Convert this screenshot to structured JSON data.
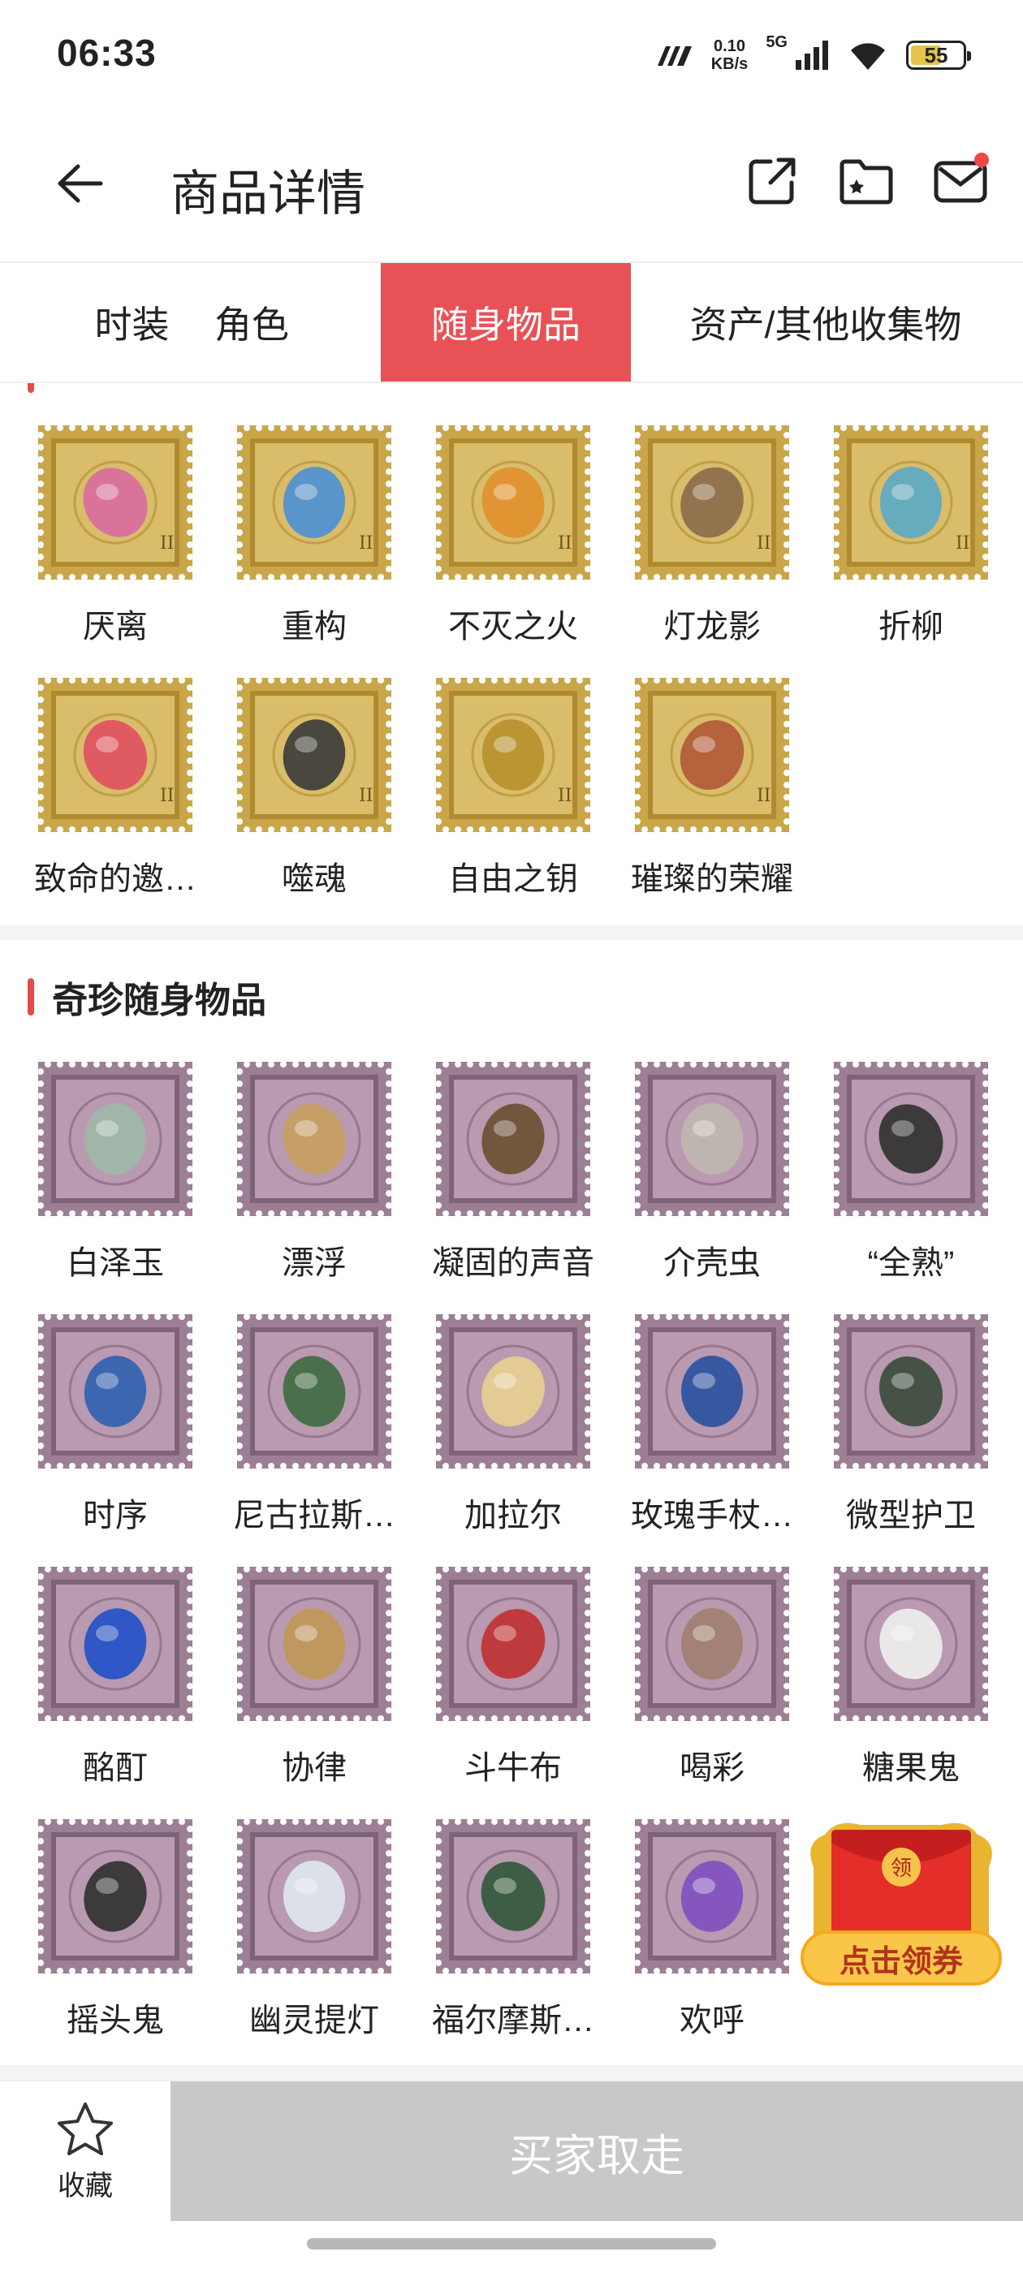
{
  "status": {
    "time": "06:33",
    "speed_value": "0.10",
    "speed_unit": "KB/s",
    "network": "5G",
    "battery": "55"
  },
  "header": {
    "title": "商品详情"
  },
  "tabs": [
    {
      "label": "时装"
    },
    {
      "label": "角色"
    },
    {
      "label": "随身物品",
      "active": true
    },
    {
      "label": "资产/其他收集物"
    }
  ],
  "section1": {
    "items": [
      {
        "name": "厌离"
      },
      {
        "name": "重构"
      },
      {
        "name": "不灭之火"
      },
      {
        "name": "灯龙影"
      },
      {
        "name": "折柳"
      },
      {
        "name": "致命的邀…"
      },
      {
        "name": "噬魂"
      },
      {
        "name": "自由之钥"
      },
      {
        "name": "璀璨的荣耀"
      }
    ]
  },
  "section2": {
    "title": "奇珍随身物品",
    "items": [
      {
        "name": "白泽玉"
      },
      {
        "name": "漂浮"
      },
      {
        "name": "凝固的声音"
      },
      {
        "name": "介壳虫"
      },
      {
        "name": "“全熟”"
      },
      {
        "name": "时序"
      },
      {
        "name": "尼古拉斯…"
      },
      {
        "name": "加拉尔"
      },
      {
        "name": "玫瑰手杖…"
      },
      {
        "name": "微型护卫"
      },
      {
        "name": "酩酊"
      },
      {
        "name": "协律"
      },
      {
        "name": "斗牛布"
      },
      {
        "name": "喝彩"
      },
      {
        "name": "糖果鬼"
      },
      {
        "name": "摇头鬼"
      },
      {
        "name": "幽灵提灯"
      },
      {
        "name": "福尔摩斯…"
      },
      {
        "name": "欢呼"
      }
    ]
  },
  "coupon": {
    "badge": "领",
    "label": "点击领券"
  },
  "bottom": {
    "favorite_label": "收藏",
    "buy_label": "买家取走"
  },
  "colors": {
    "accent": "#e85257",
    "gold_stamp": "#c9a64a",
    "purple_stamp": "#9c7f95",
    "buy_disabled": "#c8c8c8"
  }
}
